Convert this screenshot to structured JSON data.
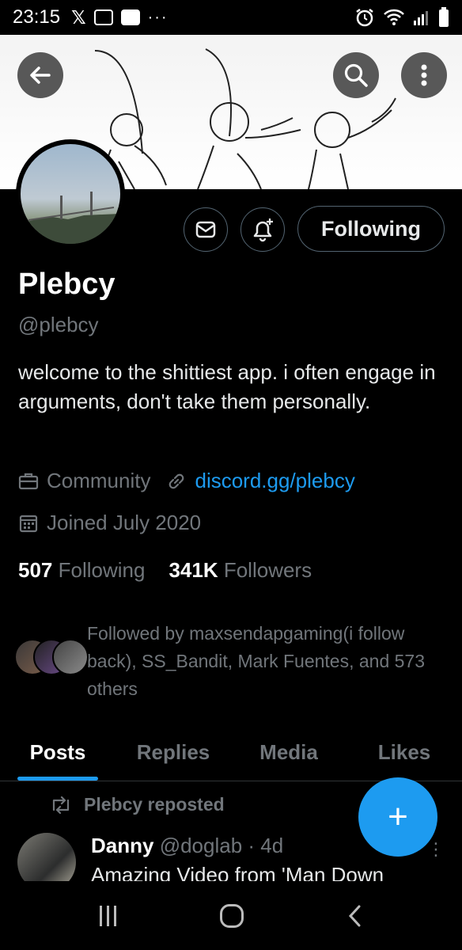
{
  "status_bar": {
    "time": "23:15",
    "x_glyph": "𝕏",
    "more": "···"
  },
  "banner": {
    "back_icon": "arrow-left-icon",
    "search_icon": "search-icon",
    "more_icon": "more-vertical-icon"
  },
  "profile": {
    "name": "Plebcy",
    "handle": "@plebcy",
    "bio": "welcome to the shittiest app. i often engage in arguments, don't take them personally.",
    "category": "Community",
    "link": "discord.gg/plebcy",
    "joined": "Joined July 2020",
    "following_count": "507",
    "following_label": "Following",
    "followers_count": "341K",
    "followers_label": "Followers",
    "followed_by": "Followed by maxsendapgaming(i follow back), SS_Bandit, Mark Fuentes, and 573 others"
  },
  "actions": {
    "following_button": "Following"
  },
  "tabs": [
    {
      "label": "Posts",
      "active": true
    },
    {
      "label": "Replies",
      "active": false
    },
    {
      "label": "Media",
      "active": false
    },
    {
      "label": "Likes",
      "active": false
    }
  ],
  "post": {
    "repost_label": "Plebcy reposted",
    "author_name": "Danny",
    "author_handle_time": "@doglab · 4d",
    "text": "Amazing Video from 'Man Down"
  },
  "fab": {
    "label": "+"
  },
  "colors": {
    "accent": "#1d9bf0",
    "background": "#000000",
    "secondary_text": "#71767b"
  }
}
